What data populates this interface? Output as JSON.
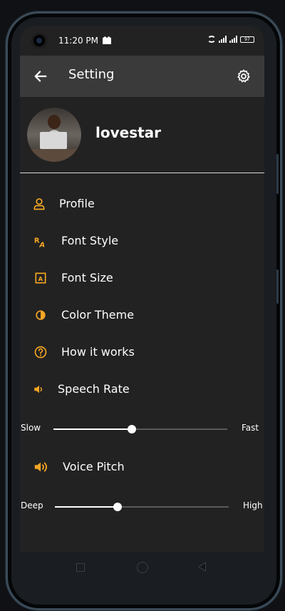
{
  "status_bar": {
    "time": "11:20 PM",
    "battery": "97"
  },
  "appbar": {
    "title": "Setting"
  },
  "profile": {
    "username": "lovestar"
  },
  "menu": [
    {
      "label": "Profile",
      "icon": "user-icon"
    },
    {
      "label": "Font Style",
      "icon": "font-style-icon"
    },
    {
      "label": "Font Size",
      "icon": "font-size-icon"
    },
    {
      "label": "Color Theme",
      "icon": "color-theme-icon"
    },
    {
      "label": "How it works",
      "icon": "help-icon"
    },
    {
      "label": "Speech Rate",
      "icon": "speaker-icon"
    },
    {
      "label": "Voice Pitch",
      "icon": "speaker-loud-icon"
    }
  ],
  "sliders": {
    "speech_rate": {
      "min_label": "Slow",
      "max_label": "Fast",
      "value": 0.45
    },
    "voice_pitch": {
      "min_label": "Deep",
      "max_label": "High",
      "value": 0.36
    }
  },
  "colors": {
    "accent": "#f5a623",
    "background": "#222222",
    "appbar": "#3a3a3a"
  }
}
